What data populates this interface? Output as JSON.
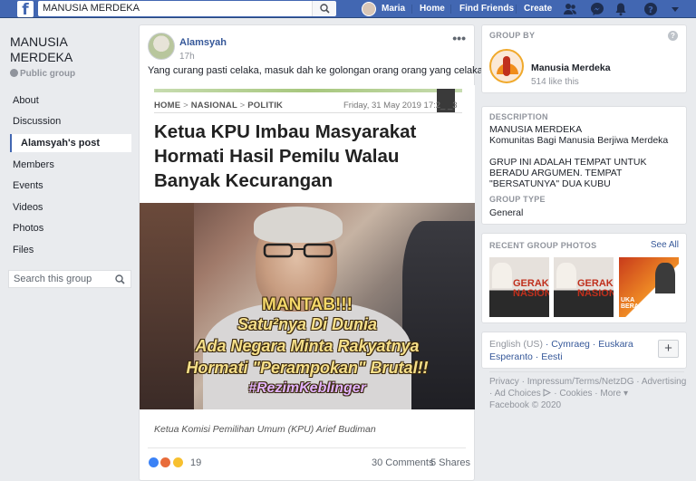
{
  "topbar": {
    "search_value": "MANUSIA MERDEKA",
    "user_name": "Maria",
    "home": "Home",
    "find_friends": "Find Friends",
    "create": "Create"
  },
  "group": {
    "name": "MANUSIA MERDEKA",
    "privacy": "Public group"
  },
  "nav": {
    "items": [
      "About",
      "Discussion",
      "Alamsyah's post",
      "Members",
      "Events",
      "Videos",
      "Photos",
      "Files"
    ],
    "search_placeholder": "Search this group"
  },
  "post": {
    "author": "Alamsyah",
    "time": "17h",
    "more": "•••",
    "text": "Yang curang pasti celaka, masuk dah ke golongan orang orang yang celaka",
    "image": {
      "breadcrumb": [
        "HOME",
        "NASIONAL",
        "POLITIK"
      ],
      "date": "Friday, 31 May 2019 17:2_ _3",
      "headline": "Ketua KPU Imbau Masyarakat Hormati Hasil Pemilu Walau Banyak Kecurangan",
      "meme_lines": [
        "MANTAB!!!",
        "Satu²nya Di Dunia",
        "Ada Negara Minta Rakyatnya",
        "Hormati \"Perampokan\" Brutal!!",
        "#RezimKeblinger"
      ],
      "caption": "Ketua Komisi Pemilihan Umum (KPU) Arief Budiman"
    },
    "reaction_count": "19",
    "comments": "30 Comments",
    "shares": "5 Shares"
  },
  "sidebar": {
    "group_by_label": "GROUP BY",
    "group_by_name": "Manusia Merdeka",
    "likes": "514 like this",
    "description_label": "DESCRIPTION",
    "description_line1": "MANUSIA MERDEKA",
    "description_line2": "Komunitas Bagi Manusia Berjiwa Merdeka",
    "description_line3": "GRUP INI ADALAH TEMPAT UNTUK BERADU ARGUMEN. TEMPAT \"BERSATUNYA\" DUA KUBU",
    "group_type_label": "GROUP TYPE",
    "group_type": "General",
    "recent_photos_label": "RECENT GROUP PHOTOS",
    "see_all": "See All",
    "photo_texts": [
      "GERAKA NASIONA",
      "GERAKA NASIONA",
      "UKA BERAGAMA"
    ],
    "languages": {
      "current": "English (US)",
      "others": [
        "Cymraeg",
        "Euskara",
        "Esperanto",
        "Eesti"
      ]
    },
    "footer_links": [
      "Privacy",
      "Impressum/Terms/NetzDG",
      "Advertising",
      "Ad Choices",
      "Cookies",
      "More"
    ],
    "copyright": "Facebook © 2020"
  },
  "colors": {
    "brand_blue": "#4267b2",
    "link_blue": "#365899",
    "background": "#e9ebee"
  }
}
